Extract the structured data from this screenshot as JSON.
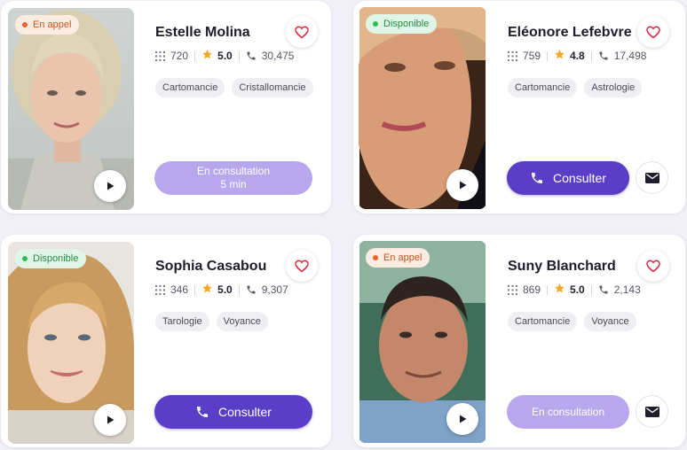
{
  "colors": {
    "primary": "#5b3ec8",
    "busy_button": "#b9a7ee",
    "status_call": "#e8622a",
    "status_available": "#2ebd59",
    "star": "#f5a623",
    "heart": "#e0304e"
  },
  "icons": [
    "play-icon",
    "heart-icon",
    "grid-icon",
    "star-icon",
    "phone-icon",
    "mail-icon"
  ],
  "cards": [
    {
      "status": "En appel",
      "name": "Estelle Molina",
      "consultations": "720",
      "rating": "5.0",
      "calls": "30,475",
      "tags": [
        "Cartomancie",
        "Cristallomancie"
      ],
      "button_line1": "En consultation",
      "button_line2": "5 min"
    },
    {
      "status": "Disponible",
      "name": "Eléonore Lefebvre",
      "consultations": "759",
      "rating": "4.8",
      "calls": "17,498",
      "tags": [
        "Cartomancie",
        "Astrologie"
      ],
      "button_label": "Consulter"
    },
    {
      "status": "Disponible",
      "name": "Sophia Casabou",
      "consultations": "346",
      "rating": "5.0",
      "calls": "9,307",
      "tags": [
        "Tarologie",
        "Voyance"
      ],
      "button_label": "Consulter"
    },
    {
      "status": "En appel",
      "name": "Suny Blanchard",
      "consultations": "869",
      "rating": "5.0",
      "calls": "2,143",
      "tags": [
        "Cartomancie",
        "Voyance"
      ],
      "button_label": "En consultation"
    }
  ]
}
